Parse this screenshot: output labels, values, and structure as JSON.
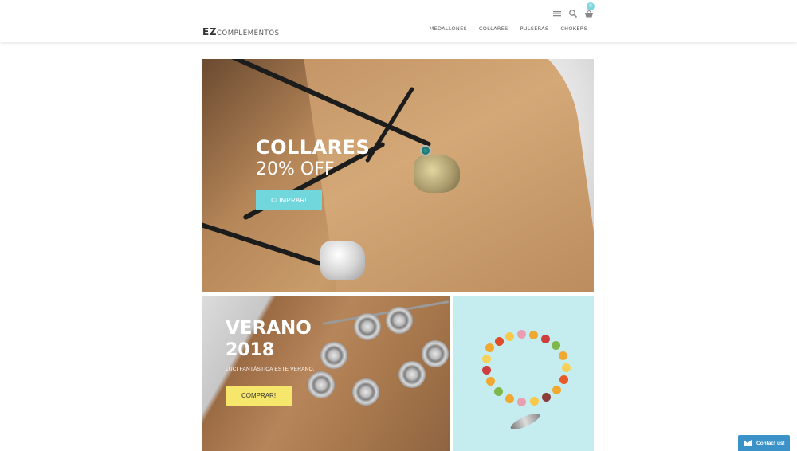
{
  "header": {
    "logo_main": "EZ",
    "logo_rest": "COMPLEMENTOS",
    "cart_count": "0",
    "icons": [
      "menu-icon",
      "search-icon",
      "basket-icon"
    ]
  },
  "nav": {
    "items": [
      {
        "label": "MEDALLONES"
      },
      {
        "label": "COLLARES"
      },
      {
        "label": "PULSERAS"
      },
      {
        "label": "CHOKERS"
      }
    ]
  },
  "hero": {
    "title": "COLLARES",
    "subtitle": "20% OFF",
    "button": "COMPRAR!"
  },
  "summer": {
    "title": "VERANO",
    "year": "2018",
    "note": "LUCI FANTÁSTICA ESTE VERANO.",
    "button": "COMPRAR!"
  },
  "contact": {
    "label": "Contact us!"
  },
  "colors": {
    "accent_teal": "#71d7dc",
    "accent_yellow": "#f6e66b",
    "contact_blue": "#3b92c9"
  }
}
